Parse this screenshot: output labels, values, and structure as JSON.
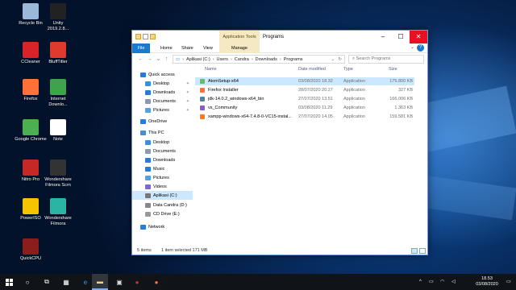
{
  "desktop": {
    "icons": [
      {
        "label": "Recycle Bin",
        "icon": "recycle-bin-icon",
        "color": "#9bb8d8"
      },
      {
        "label": "Unity 2019.2.8...",
        "icon": "unity-icon",
        "color": "#222222"
      },
      {
        "label": "CCleaner",
        "icon": "ccleaner-icon",
        "color": "#d8232a"
      },
      {
        "label": "BluffTitler",
        "icon": "blufftitler-icon",
        "color": "#e03a2f"
      },
      {
        "label": "Firefox",
        "icon": "firefox-icon",
        "color": "#ff7139"
      },
      {
        "label": "Internet Downlo...",
        "icon": "idm-icon",
        "color": "#3fa34d"
      },
      {
        "label": "Google Chrome",
        "icon": "chrome-icon",
        "color": "#4caf50"
      },
      {
        "label": "Note",
        "icon": "note-icon",
        "color": "#ffffff"
      },
      {
        "label": "Nitro Pro",
        "icon": "nitro-icon",
        "color": "#c62828"
      },
      {
        "label": "Wondershare Filmora Scrn",
        "icon": "filmora-scrn-icon",
        "color": "#333333"
      },
      {
        "label": "PowerISO",
        "icon": "poweriso-icon",
        "color": "#f5c400"
      },
      {
        "label": "Wondershare Filmora",
        "icon": "filmora-icon",
        "color": "#2bb3a3"
      },
      {
        "label": "QuickCPU",
        "icon": "quickcpu-icon",
        "color": "#8b1d1d"
      }
    ]
  },
  "window": {
    "title": "Programs",
    "context_tab": "Application Tools",
    "ribbon_tabs": [
      "File",
      "Home",
      "Share",
      "View",
      "Manage"
    ],
    "address_path": [
      "Aplikasi (C:)",
      "Users",
      "Candra",
      "Downloads",
      "Programs"
    ],
    "search_placeholder": "Search Programs",
    "nav": [
      {
        "label": "Quick access",
        "icon": "star-icon",
        "color": "#2b7bd3"
      },
      {
        "label": "Desktop",
        "icon": "desktop-icon",
        "color": "#3a8fd8",
        "pinned": true
      },
      {
        "label": "Downloads",
        "icon": "download-icon",
        "color": "#2b7bd3",
        "pinned": true
      },
      {
        "label": "Documents",
        "icon": "documents-icon",
        "color": "#8a9bb0",
        "pinned": true
      },
      {
        "label": "Pictures",
        "icon": "pictures-icon",
        "color": "#5aa0d8",
        "pinned": true
      },
      {
        "label": "OneDrive",
        "icon": "onedrive-icon",
        "color": "#2b7bd3"
      },
      {
        "label": "This PC",
        "icon": "pc-icon",
        "color": "#4a90c8"
      },
      {
        "label": "Desktop",
        "icon": "desktop-icon",
        "color": "#3a8fd8"
      },
      {
        "label": "Documents",
        "icon": "documents-icon",
        "color": "#8a9bb0"
      },
      {
        "label": "Downloads",
        "icon": "download-icon",
        "color": "#2b7bd3"
      },
      {
        "label": "Music",
        "icon": "music-icon",
        "color": "#2b7bd3"
      },
      {
        "label": "Pictures",
        "icon": "pictures-icon",
        "color": "#5aa0d8"
      },
      {
        "label": "Videos",
        "icon": "videos-icon",
        "color": "#7a6ad0"
      },
      {
        "label": "Aplikasi (C:)",
        "icon": "drive-icon",
        "color": "#777777",
        "selected": true
      },
      {
        "label": "Data Candra (D:)",
        "icon": "drive-icon",
        "color": "#888888"
      },
      {
        "label": "CD Drive (E:)",
        "icon": "cd-icon",
        "color": "#999999"
      },
      {
        "label": "Network",
        "icon": "network-icon",
        "color": "#2b7bd3"
      }
    ],
    "columns": [
      "Name",
      "Date modified",
      "Type",
      "Size"
    ],
    "files": [
      {
        "name": "AtomSetup-x64",
        "date": "03/08/2020 18.32",
        "type": "Application",
        "size": "175.800 KB",
        "icon": "atom-icon",
        "color": "#66bb6a",
        "selected": true
      },
      {
        "name": "Firefox Installer",
        "date": "28/07/2020 20.27",
        "type": "Application",
        "size": "327 KB",
        "icon": "firefox-icon",
        "color": "#ff7139"
      },
      {
        "name": "jdk-14.0.2_windows-x64_bin",
        "date": "27/07/2020 13.51",
        "type": "Application",
        "size": "166.006 KB",
        "icon": "java-icon",
        "color": "#5382a1"
      },
      {
        "name": "vs_Community",
        "date": "03/08/2020 11.29",
        "type": "Application",
        "size": "1.363 KB",
        "icon": "visual-studio-icon",
        "color": "#865fc5"
      },
      {
        "name": "xampp-windows-x64-7.4.8-0-VC15-instal...",
        "date": "27/07/2020 14.05",
        "type": "Application",
        "size": "159.581 KB",
        "icon": "xampp-icon",
        "color": "#fb7a24"
      }
    ],
    "status": {
      "count": "5 items",
      "selection": "1 item selected  171 MB"
    }
  },
  "taskbar": {
    "clock_time": "18.53",
    "clock_date": "03/08/2020",
    "colors": {
      "active_underline": "#7ab0f0",
      "bar": "#101318"
    }
  }
}
